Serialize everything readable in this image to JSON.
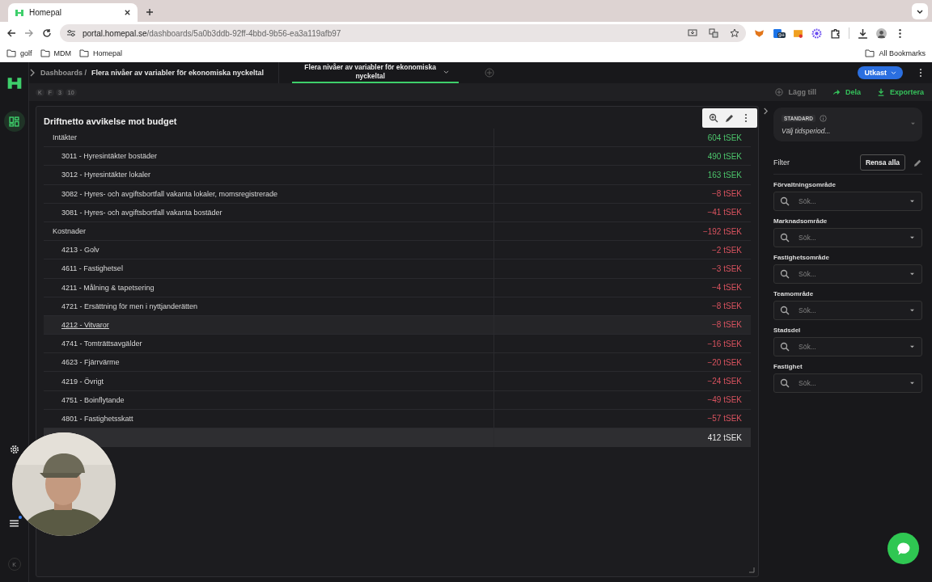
{
  "browser": {
    "tab_title": "Homepal",
    "url_host": "portal.homepal.se",
    "url_path": "/dashboards/5a0b3ddb-92ff-4bbd-9b56-ea3a119afb97",
    "extension_badge": "9+",
    "bookmarks": [
      "golf",
      "MDM",
      "Homepal"
    ],
    "all_bookmarks": "All Bookmarks"
  },
  "topbar": {
    "breadcrumb_root": "Dashboards /",
    "breadcrumb_current": "Flera nivåer av variabler för ekonomiska nyckeltal",
    "tabs": [
      {
        "label": "Flera nivåer av variabler för ekonomiska nyckeltal",
        "selected": true
      }
    ],
    "status_button": "Utkast"
  },
  "shortcut_keys": [
    "K",
    "F",
    "3",
    "10"
  ],
  "actions": [
    {
      "kind": "add",
      "label": "Lägg till",
      "disabled": true
    },
    {
      "kind": "share",
      "label": "Dela",
      "disabled": false
    },
    {
      "kind": "export",
      "label": "Exportera",
      "disabled": false
    }
  ],
  "card": {
    "title": "Driftnetto avvikelse mot budget",
    "rows": [
      {
        "kind": "group",
        "label": "Intäkter",
        "value": "604 tSEK",
        "color": "#4cc36b",
        "highlighted": false
      },
      {
        "kind": "item",
        "label": "3011 - Hyresintäkter bostäder",
        "value": "490 tSEK",
        "color": "#4cc36b",
        "highlighted": false
      },
      {
        "kind": "item",
        "label": "3012 - Hyresintäkter lokaler",
        "value": "163 tSEK",
        "color": "#4cc36b",
        "highlighted": false
      },
      {
        "kind": "item",
        "label": "3082 - Hyres- och avgiftsbortfall vakanta lokaler, momsregistrerade",
        "value": "−8 tSEK",
        "color": "#d9535f",
        "highlighted": false
      },
      {
        "kind": "item",
        "label": "3081 - Hyres- och avgiftsbortfall vakanta bostäder",
        "value": "−41 tSEK",
        "color": "#d9535f",
        "highlighted": false
      },
      {
        "kind": "group",
        "label": "Kostnader",
        "value": "−192 tSEK",
        "color": "#d9535f",
        "highlighted": false
      },
      {
        "kind": "item",
        "label": "4213 - Golv",
        "value": "−2 tSEK",
        "color": "#d9535f",
        "highlighted": false
      },
      {
        "kind": "item",
        "label": "4611 - Fastighetsel",
        "value": "−3 tSEK",
        "color": "#d9535f",
        "highlighted": false
      },
      {
        "kind": "item",
        "label": "4211 - Målning & tapetsering",
        "value": "−4 tSEK",
        "color": "#d9535f",
        "highlighted": false
      },
      {
        "kind": "item",
        "label": "4721 - Ersättning för men i nyttjanderätten",
        "value": "−8 tSEK",
        "color": "#d9535f",
        "highlighted": false
      },
      {
        "kind": "item",
        "label": "4212 - Vitvaror",
        "value": "−8 tSEK",
        "color": "#d9535f",
        "highlighted": true
      },
      {
        "kind": "item",
        "label": "4741 - Tomträttsavgälder",
        "value": "−16 tSEK",
        "color": "#d9535f",
        "highlighted": false
      },
      {
        "kind": "item",
        "label": "4623 - Fjärrvärme",
        "value": "−20 tSEK",
        "color": "#d9535f",
        "highlighted": false
      },
      {
        "kind": "item",
        "label": "4219 - Övrigt",
        "value": "−24 tSEK",
        "color": "#d9535f",
        "highlighted": false
      },
      {
        "kind": "item",
        "label": "4751 - Boinflytande",
        "value": "−49 tSEK",
        "color": "#d9535f",
        "highlighted": false
      },
      {
        "kind": "item",
        "label": "4801 - Fastighetsskatt",
        "value": "−57 tSEK",
        "color": "#d9535f",
        "highlighted": false
      },
      {
        "kind": "total",
        "value": "412 tSEK",
        "color": "#e8e8e8",
        "highlighted": false
      }
    ]
  },
  "panel": {
    "badge": "STANDARD",
    "period_placeholder": "Välj tidsperiod...",
    "filter_title": "Filter",
    "clear_button": "Rensa alla",
    "filters": [
      {
        "label": "Förvaltningsområde",
        "placeholder": "Sök..."
      },
      {
        "label": "Marknadsområde",
        "placeholder": "Sök..."
      },
      {
        "label": "Fastighetsområde",
        "placeholder": "Sök..."
      },
      {
        "label": "Teamområde",
        "placeholder": "Sök..."
      },
      {
        "label": "Stadsdel",
        "placeholder": "Sök..."
      },
      {
        "label": "Fastighet",
        "placeholder": "Sök..."
      }
    ]
  },
  "rail": {
    "user_initial": "K",
    "notification": true
  }
}
